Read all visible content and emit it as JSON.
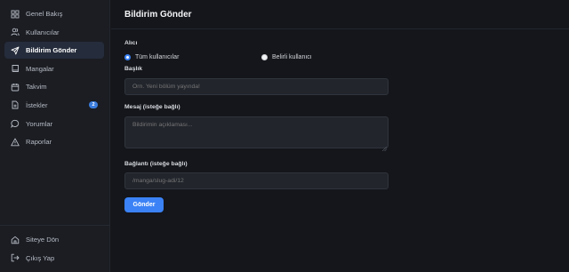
{
  "sidebar": {
    "items": [
      {
        "label": "Genel Bakış",
        "icon": "grid-icon"
      },
      {
        "label": "Kullanıcılar",
        "icon": "users-icon"
      },
      {
        "label": "Bildirim Gönder",
        "icon": "send-icon"
      },
      {
        "label": "Mangalar",
        "icon": "book-icon"
      },
      {
        "label": "Takvim",
        "icon": "calendar-icon"
      },
      {
        "label": "İstekler",
        "icon": "file-icon",
        "badge": "2"
      },
      {
        "label": "Yorumlar",
        "icon": "comment-icon"
      },
      {
        "label": "Raporlar",
        "icon": "warning-icon"
      }
    ],
    "bottom": [
      {
        "label": "Siteye Dön",
        "icon": "home-icon"
      },
      {
        "label": "Çıkış Yap",
        "icon": "logout-icon"
      }
    ]
  },
  "header": {
    "title": "Bildirim Gönder"
  },
  "form": {
    "recipient_label": "Alıcı",
    "option_all": "Tüm kullanıcılar",
    "option_specific": "Belirli kullanıcı",
    "title_label": "Başlık",
    "title_placeholder": "Örn. Yeni bölüm yayında!",
    "message_label": "Mesaj (isteğe bağlı)",
    "message_placeholder": "Bildirimin açıklaması...",
    "link_label": "Bağlantı (isteğe bağlı)",
    "link_placeholder": "/manga/slug-adi/12",
    "submit_label": "Gönder"
  },
  "colors": {
    "accent": "#3b82f6",
    "background": "#14161b",
    "sidebar": "#1b1d23"
  }
}
